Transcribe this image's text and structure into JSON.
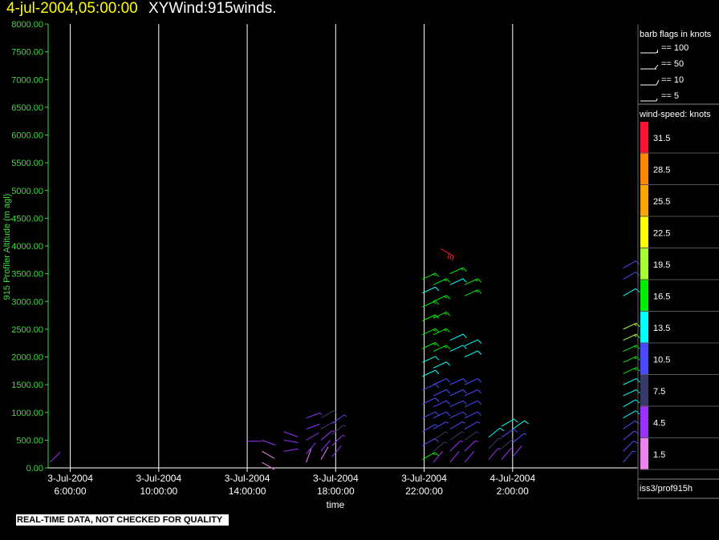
{
  "header": {
    "date": "4-jul-2004,05:00:00",
    "title": "XYWind:915winds."
  },
  "note": "REAL-TIME DATA, NOT CHECKED FOR QUALITY",
  "colors": {
    "axis_y": "#3ddc3d",
    "grid": "#ffffff",
    "title_date": "#ffff00"
  },
  "legend": {
    "barb_title": "barb flags in knots",
    "barb_entries": [
      "== 100",
      "== 50",
      "== 10",
      "== 5"
    ],
    "speed_title": "wind-speed: knots",
    "speed_colors": [
      "#ee82ee",
      "#9b30ff",
      "#3a3a6a",
      "#4a4aff",
      "#00ffff",
      "#00ee00",
      "#a8ff30",
      "#ffff00",
      "#ffa500",
      "#ff8800",
      "#ff1133"
    ],
    "speed_labels": [
      "1.5",
      "4.5",
      "7.5",
      "10.5",
      "13.5",
      "16.5",
      "19.5",
      "22.5",
      "25.5",
      "28.5",
      "31.5"
    ],
    "source": "iss3/prof915h"
  },
  "chart_data": {
    "type": "scatter",
    "title": "XYWind:915winds.",
    "xlabel": "time",
    "ylabel": "915 Profiler Altitude (m agl)",
    "ylim": [
      0,
      8000
    ],
    "xlim": [
      "3-Jul-2004 5:00",
      "4-Jul-2004 7:40"
    ],
    "yticks": [
      "0.00",
      "500.00",
      "1000.00",
      "1500.00",
      "2000.00",
      "2500.00",
      "3000.00",
      "3500.00",
      "4000.00",
      "4500.00",
      "5000.00",
      "5500.00",
      "6000.00",
      "6500.00",
      "7000.00",
      "7500.00",
      "8000.00"
    ],
    "xticks": [
      {
        "date": "3-Jul-2004",
        "time": "6:00:00"
      },
      {
        "date": "3-Jul-2004",
        "time": "10:00:00"
      },
      {
        "date": "3-Jul-2004",
        "time": "14:00:00"
      },
      {
        "date": "3-Jul-2004",
        "time": "18:00:00"
      },
      {
        "date": "3-Jul-2004",
        "time": "22:00:00"
      },
      {
        "date": "4-Jul-2004",
        "time": "2:00:00"
      }
    ],
    "grid": true,
    "profiles": [
      {
        "time": "3-Jul-2004 5:05",
        "heights": [
          100
        ],
        "speeds": [
          3
        ],
        "dirs": [
          225
        ]
      },
      {
        "time": "3-Jul-2004 14:00",
        "heights": [
          480
        ],
        "speeds": [
          3
        ],
        "dirs": [
          270
        ]
      },
      {
        "time": "3-Jul-2004 14:40",
        "heights": [
          100,
          300,
          500
        ],
        "speeds": [
          2,
          2,
          3
        ],
        "dirs": [
          300,
          300,
          290
        ]
      },
      {
        "time": "3-Jul-2004 15:40",
        "heights": [
          300,
          500,
          650
        ],
        "speeds": [
          4,
          4,
          3
        ],
        "dirs": [
          260,
          280,
          290
        ]
      },
      {
        "time": "3-Jul-2004 16:40",
        "heights": [
          100,
          250,
          500,
          700,
          900
        ],
        "speeds": [
          2,
          3,
          3,
          4,
          5
        ],
        "dirs": [
          200,
          220,
          240,
          250,
          250
        ]
      },
      {
        "time": "3-Jul-2004 17:20",
        "heights": [
          150,
          300,
          500,
          700,
          900
        ],
        "speeds": [
          2,
          3,
          5,
          7,
          8
        ],
        "dirs": [
          210,
          220,
          230,
          240,
          240
        ]
      },
      {
        "time": "3-Jul-2004 17:50",
        "heights": [
          200,
          400,
          600,
          800
        ],
        "speeds": [
          3,
          5,
          7,
          9
        ],
        "dirs": [
          220,
          225,
          230,
          235
        ]
      },
      {
        "time": "3-Jul-2004 21:55",
        "heights": [
          150,
          400,
          650,
          900,
          1150,
          1400,
          1650,
          1900,
          2150,
          2400,
          2650,
          2900,
          3150,
          3400
        ],
        "speeds": [
          16,
          11,
          9,
          10,
          11,
          11,
          12,
          14,
          16,
          16,
          15,
          16,
          14,
          15
        ],
        "dirs": [
          240,
          240,
          240,
          245,
          245,
          245,
          245,
          245,
          245,
          245,
          245,
          245,
          245,
          245
        ]
      },
      {
        "time": "3-Jul-2004 22:25",
        "heights": [
          100,
          300,
          500,
          700,
          900,
          1100,
          1300,
          1500,
          1800,
          2100,
          2400,
          2700,
          3000,
          3300
        ],
        "speeds": [
          4,
          6,
          8,
          9,
          10,
          11,
          11,
          11,
          14,
          16,
          16,
          17,
          16,
          17
        ],
        "dirs": [
          220,
          230,
          235,
          240,
          245,
          245,
          245,
          245,
          245,
          245,
          245,
          245,
          245,
          245
        ]
      },
      {
        "time": "3-Jul-2004 22:45",
        "heights": [
          3950
        ],
        "speeds": [
          31
        ],
        "dirs": [
          300
        ]
      },
      {
        "time": "3-Jul-2004 23:10",
        "heights": [
          100,
          300,
          500,
          700,
          900,
          1100,
          1300,
          1500,
          2100,
          2300,
          3300,
          3500
        ],
        "speeds": [
          4,
          5,
          7,
          9,
          10,
          11,
          11,
          11,
          14,
          14,
          14,
          15
        ],
        "dirs": [
          220,
          225,
          235,
          240,
          245,
          245,
          245,
          245,
          245,
          245,
          245,
          245
        ]
      },
      {
        "time": "3-Jul-2004 23:50",
        "heights": [
          100,
          300,
          500,
          700,
          900,
          1100,
          1300,
          1500,
          2000,
          2200,
          3100,
          3300
        ],
        "speeds": [
          4,
          5,
          7,
          9,
          10,
          11,
          11,
          11,
          13,
          14,
          16,
          17
        ],
        "dirs": [
          220,
          225,
          235,
          240,
          245,
          245,
          245,
          245,
          245,
          245,
          245,
          245
        ]
      },
      {
        "time": "4-Jul-2004 0:55",
        "heights": [
          150,
          350,
          550
        ],
        "speeds": [
          5,
          8,
          13
        ],
        "dirs": [
          220,
          225,
          230
        ]
      },
      {
        "time": "4-Jul-2004 1:30",
        "heights": [
          150,
          350,
          550,
          750
        ],
        "speeds": [
          5,
          8,
          11,
          13
        ],
        "dirs": [
          220,
          230,
          235,
          240
        ]
      },
      {
        "time": "4-Jul-2004 2:00",
        "heights": [
          200,
          450,
          700
        ],
        "speeds": [
          4,
          9,
          12
        ],
        "dirs": [
          220,
          230,
          235
        ]
      },
      {
        "time": "4-Jul-2004 7:00",
        "heights": [
          100,
          300,
          500,
          700,
          900,
          1100,
          1300,
          1500,
          1700,
          1900,
          2100,
          2300,
          2500,
          3100,
          3400,
          3600
        ],
        "speeds": [
          9,
          10,
          10,
          11,
          12,
          13,
          13,
          14,
          16,
          17,
          17,
          18,
          18,
          13,
          11,
          11
        ],
        "dirs": [
          220,
          225,
          230,
          235,
          240,
          240,
          245,
          245,
          245,
          245,
          245,
          245,
          245,
          240,
          240,
          240
        ]
      }
    ]
  }
}
